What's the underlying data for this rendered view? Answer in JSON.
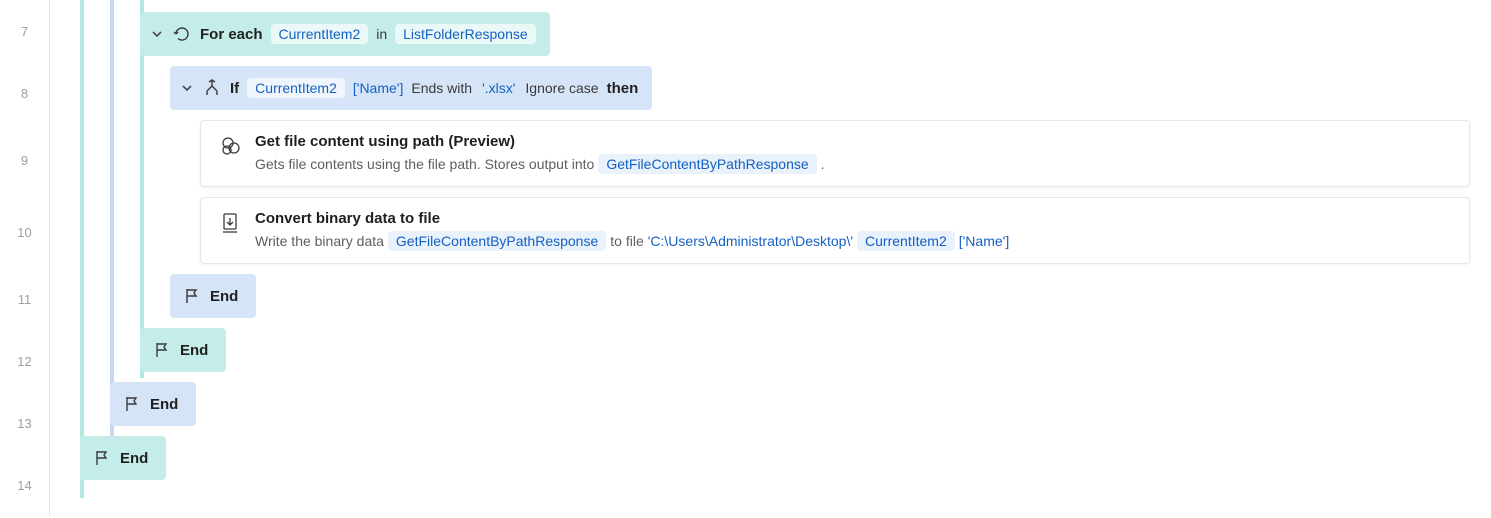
{
  "lines": {
    "l7": "7",
    "l8": "8",
    "l9": "9",
    "l10": "10",
    "l11": "11",
    "l12": "12",
    "l13": "13",
    "l14": "14"
  },
  "foreach": {
    "keyword": "For each",
    "var": "CurrentItem2",
    "in": "in",
    "collection": "ListFolderResponse"
  },
  "ifblock": {
    "keyword": "If",
    "var": "CurrentItem2",
    "prop": "['Name']",
    "op": "Ends with",
    "value": "'.xlsx'",
    "opt": "Ignore case",
    "then": "then"
  },
  "action1": {
    "title": "Get file content using path (Preview)",
    "desc1": "Gets file contents using the file path. Stores output into",
    "out": "GetFileContentByPathResponse",
    "dot": "."
  },
  "action2": {
    "title": "Convert binary data to file",
    "desc1": "Write the binary data",
    "in": "GetFileContentByPathResponse",
    "desc2": "to file",
    "path": "'C:\\Users\\Administrator\\Desktop\\'",
    "var": "CurrentItem2",
    "prop": "['Name']"
  },
  "end": "End"
}
